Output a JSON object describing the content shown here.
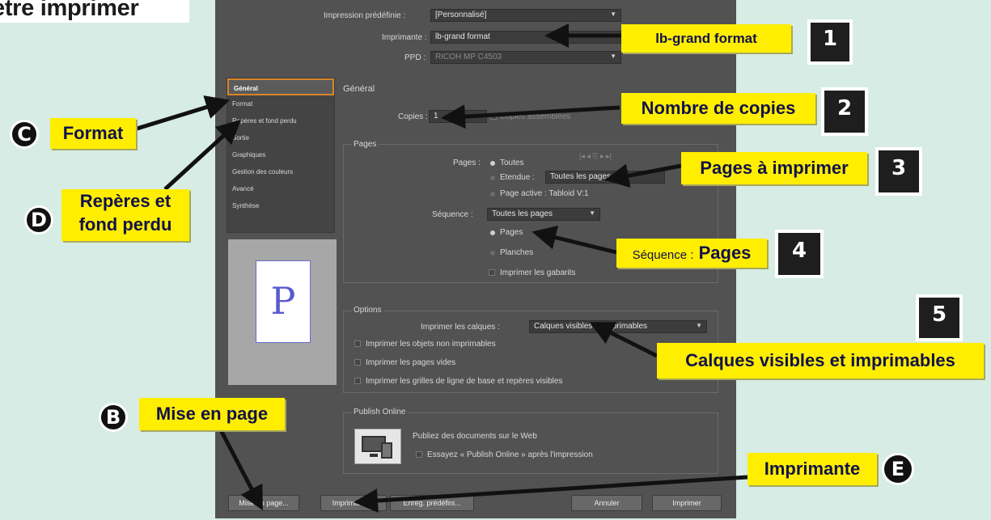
{
  "header": {
    "title": "etre imprimer"
  },
  "dialog": {
    "preset_label": "Impression prédéfinie :",
    "preset_value": "[Personnalisé]",
    "printer_label": "Imprimante :",
    "printer_value": "lb-grand format",
    "ppd_label": "PPD :",
    "ppd_value": "RICOH MP C4503",
    "sidebar": [
      "Général",
      "Format",
      "Repères et fond perdu",
      "Sortie",
      "Graphiques",
      "Gestion des couleurs",
      "Avancé",
      "Synthèse"
    ],
    "preview_letter": "P",
    "section_title": "Général",
    "copies_label": "Copies :",
    "copies_value": "1",
    "collate_label": "Copies assemblées",
    "pages_group": "Pages",
    "pages_label": "Pages :",
    "all_label": "Toutes",
    "range_label": "Etendue :",
    "range_value": "Toutes les pages",
    "active_label": "Page active : Tabloid V:1",
    "sequence_label": "Séquence :",
    "sequence_value": "Toutes les pages",
    "opt_pages": "Pages",
    "opt_spreads": "Planches",
    "print_masters": "Imprimer les gabarits",
    "options_group": "Options",
    "layers_label": "Imprimer les calques :",
    "layers_value": "Calques visibles et imprimables",
    "chk_nonprinting": "Imprimer les objets non imprimables",
    "chk_blank": "Imprimer les pages vides",
    "chk_grids": "Imprimer les grilles de ligne de base et repères visibles",
    "publish_group": "Publish Online",
    "publish_text": "Publiez des documents sur le Web",
    "publish_chk": "Essayez « Publish Online » après l'impression",
    "buttons": {
      "setup": "Mise en page...",
      "printer": "Imprimante...",
      "save": "Enreg. prédéfini...",
      "cancel": "Annuler",
      "print": "Imprimer"
    }
  },
  "callouts": {
    "c1": "lb-grand format",
    "n1": "1",
    "c2": "Nombre de copies",
    "n2": "2",
    "c3": "Pages à imprimer",
    "n3": "3",
    "c4_small": "Séquence :",
    "c4_big": "Pages",
    "n4": "4",
    "n5": "5",
    "c5": "Calques visibles et imprimables",
    "cC": "Format",
    "lC": "C",
    "cD1": "Repères et",
    "cD2": "fond perdu",
    "lD": "D",
    "cB": "Mise en page",
    "lB": "B",
    "cE": "Imprimante",
    "lE": "E"
  },
  "colors": {
    "callout_bg": "#ffee00",
    "callout_text": "#12124a",
    "dialog_bg": "#525252",
    "page_bg": "#d6ece4"
  }
}
